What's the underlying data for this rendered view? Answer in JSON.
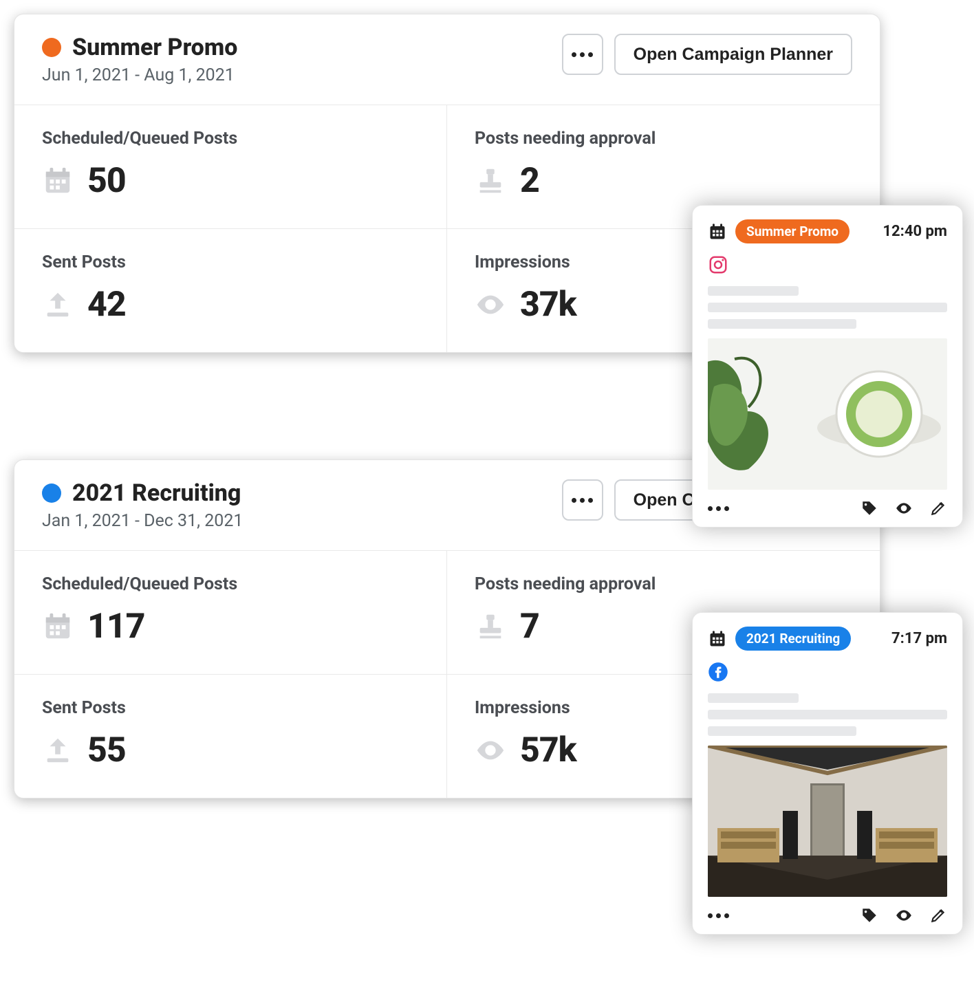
{
  "campaigns": [
    {
      "title": "Summer Promo",
      "dates": "Jun 1, 2021 - Aug 1, 2021",
      "dot_color": "#ef6a1f",
      "actions": {
        "more": "more",
        "open": "Open Campaign Planner"
      },
      "stats": {
        "scheduled": {
          "label": "Scheduled/Queued Posts",
          "value": "50"
        },
        "needs_approval": {
          "label": "Posts needing approval",
          "value": "2"
        },
        "sent": {
          "label": "Sent Posts",
          "value": "42"
        },
        "impressions": {
          "label": "Impressions",
          "value": "37k"
        }
      }
    },
    {
      "title": "2021 Recruiting",
      "dates": "Jan 1, 2021 - Dec 31, 2021",
      "dot_color": "#1981e8",
      "actions": {
        "more": "more",
        "open": "Open Campaign Planner"
      },
      "stats": {
        "scheduled": {
          "label": "Scheduled/Queued Posts",
          "value": "117"
        },
        "needs_approval": {
          "label": "Posts needing approval",
          "value": "7"
        },
        "sent": {
          "label": "Sent Posts",
          "value": "55"
        },
        "impressions": {
          "label": "Impressions",
          "value": "57k"
        }
      }
    }
  ],
  "posts": [
    {
      "chip_label": "Summer Promo",
      "chip_color": "#ef6a1f",
      "time": "12:40 pm",
      "network": "instagram",
      "image_alt": "Matcha latte with plant"
    },
    {
      "chip_label": "2021 Recruiting",
      "chip_color": "#1981e8",
      "time": "7:17 pm",
      "network": "facebook",
      "image_alt": "Retail store interior"
    }
  ]
}
